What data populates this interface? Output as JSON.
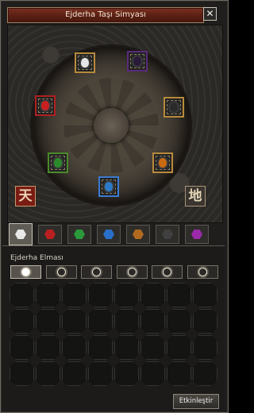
{
  "window": {
    "title": "Ejderha Taşı Simyası",
    "close_glyph": "✕"
  },
  "altar": {
    "sky_char": "天",
    "earth_char": "地",
    "slots": [
      {
        "name": "diamond",
        "gem_color": "#e6e6e6",
        "frame_color": "#b88a3a"
      },
      {
        "name": "amethyst",
        "gem_color": "#2a1a3a",
        "frame_color": "#5a2a7a"
      },
      {
        "name": "ruby",
        "gem_color": "#c82020",
        "frame_color": "#b02020"
      },
      {
        "name": "onyx",
        "gem_color": "#2a2a2a",
        "frame_color": "#b88a3a"
      },
      {
        "name": "jade",
        "gem_color": "#2a8a2a",
        "frame_color": "#4a8a2a"
      },
      {
        "name": "garnet",
        "gem_color": "#c86a10",
        "frame_color": "#b88a3a"
      },
      {
        "name": "sapphire",
        "gem_color": "#2a7ac8",
        "frame_color": "#3a7ad0"
      }
    ]
  },
  "tabs": [
    {
      "name": "diamond",
      "color": "#e8e8e8",
      "active": true
    },
    {
      "name": "ruby",
      "color": "#b82020",
      "active": false
    },
    {
      "name": "jade",
      "color": "#2a9a3a",
      "active": false
    },
    {
      "name": "sapphire",
      "color": "#2a70c8",
      "active": false
    },
    {
      "name": "garnet",
      "color": "#b06a20",
      "active": false
    },
    {
      "name": "onyx",
      "color": "#404040",
      "active": false
    },
    {
      "name": "amethyst",
      "color": "#9a2aa8",
      "active": false
    }
  ],
  "inventory": {
    "section_label": "Ejderha Elması",
    "grade_count": 6,
    "selected_grade": 0,
    "rows": 4,
    "cols": 8
  },
  "actions": {
    "activate_label": "Etkinleştir"
  }
}
